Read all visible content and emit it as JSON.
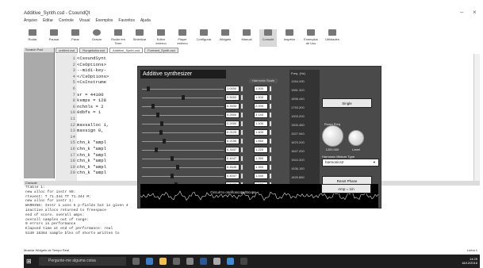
{
  "window": {
    "title": "Additive_Synth.csd - CsoundQt"
  },
  "menu": [
    "Arquivo",
    "Editar",
    "Controle",
    "Visual",
    "Exemplos",
    "Favoritos",
    "Ajuda"
  ],
  "toolbar": [
    "Rodar",
    "Pausar",
    "Parar",
    "Gravar",
    "Rodar em Term",
    "Sintetizar",
    "Editor externo",
    "Player externo",
    "Configurar",
    "Widgets",
    "Manual",
    "Console",
    "Inspetor",
    "Exemplos de Uso",
    "Utilidades"
  ],
  "left_panel": {
    "title": "Scratch Pad"
  },
  "tabs": [
    "untitled.csd",
    "Rungekutta.csd",
    "Additive_Synth.csd",
    "Formant_Synth.csd"
  ],
  "editor": {
    "lines": [
      {
        "n": "1",
        "text": "<CsoundSynt"
      },
      {
        "n": "2",
        "text": "<CsOptions>"
      },
      {
        "n": "3",
        "text": "--midi-key-"
      },
      {
        "n": "4",
        "text": "</CsOptions>"
      },
      {
        "n": "5",
        "text": "<CsInstrume"
      },
      {
        "n": "6",
        "text": ""
      },
      {
        "n": "7",
        "text": "sr = 44100"
      },
      {
        "n": "8",
        "text": "ksmps = 128"
      },
      {
        "n": "9",
        "text": "nchnls = 2"
      },
      {
        "n": "10",
        "text": "0dbfs = 1"
      },
      {
        "n": "11",
        "text": ""
      },
      {
        "n": "12",
        "text": "massalloc 1,"
      },
      {
        "n": "13",
        "text": "massign 0,"
      },
      {
        "n": "14",
        "text": ""
      },
      {
        "n": "15",
        "text": "chn_k \"ampl"
      },
      {
        "n": "16",
        "text": "chn_k \"ampl"
      },
      {
        "n": "17",
        "text": "chn_k \"ampl"
      },
      {
        "n": "18",
        "text": "chn_k \"ampl"
      },
      {
        "n": "19",
        "text": "chn_k \"ampl"
      },
      {
        "n": "20",
        "text": "chn_k \"ampl"
      }
    ]
  },
  "console": {
    "title": "Console",
    "lines": [
      "ftable 1:",
      "new alloc for instr 99:",
      "   rtevent:        T 71.344 TT 71.344 M:",
      "new alloc for instr 1:",
      "WARNING: Instr 1 uses 5 p-fields but is given 4",
      "inactive allocs returned to freespace",
      "end of score.                overall amps:",
      "           overall samples out of range:",
      "0 errors in performance",
      "Elapsed time at end of performance: real",
      "5140 16384 sample blks of shorts written to"
    ]
  },
  "status": {
    "text": "Mostrar Widgets de Tempo Real",
    "right": "Linha 1"
  },
  "taskbar": {
    "search": "Pergunte-me alguma coisa",
    "lang": "POR\nPTB2",
    "time": "14:25",
    "date": "16/12/2016"
  },
  "plugin": {
    "title": "Additive synthesizer",
    "values": [
      "1.0000",
      "0.5000",
      "0.3333",
      "0.2500",
      "0.2000",
      "0.2129",
      "0.2155",
      "0.3337",
      "0.4047",
      "0.4545",
      "0.4047",
      "0.3433"
    ],
    "harmonics": [
      "1.000",
      "1.500",
      "2.000",
      "3.140",
      "1.100",
      "1.400",
      "1.650",
      "1.220",
      "1.350",
      "1.390",
      "1.440",
      "1.660"
    ],
    "side_values": [
      "1264.430",
      "1581.320",
      "1896.440",
      "1793.200",
      "1903.200",
      "1500.480",
      "1527.940",
      "1870.200",
      "1847.200",
      "1544.320",
      "1536.150",
      "1825.880"
    ],
    "side_header": "Freq. (Hz)",
    "col_header": "Harmonic Scale",
    "buttons": {
      "single": "Single",
      "reset": "Reset Phase",
      "amp": "Amp = 1/n"
    },
    "knobs": {
      "room": "Room Freq",
      "fine": "1200.000",
      "level": "Level"
    },
    "dropdown_label": "Harmonic Mixture Type",
    "dropdown_value": "harmonics2",
    "scope_title": "Circuit to oscilloscope/Scope",
    "knob_positions": [
      0.08,
      0.52,
      0.14,
      0.2,
      0.25,
      0.24,
      0.28,
      0.18,
      0.38,
      0.45,
      0.38,
      0.43
    ]
  }
}
